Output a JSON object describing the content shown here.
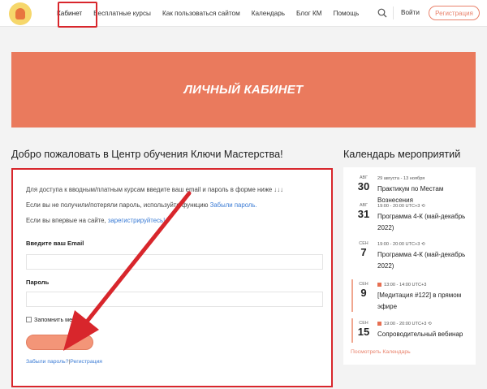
{
  "header": {
    "nav": [
      {
        "label": "Кабинет",
        "active": true
      },
      {
        "label": "Бесплатные курсы"
      },
      {
        "label": "Как пользоваться сайтом"
      },
      {
        "label": "Календарь"
      },
      {
        "label": "Блог КМ"
      },
      {
        "label": "Помощь"
      }
    ],
    "login_label": "Войти",
    "register_label": "Регистрация"
  },
  "banner": {
    "title": "ЛИЧНЫЙ КАБИНЕТ"
  },
  "main": {
    "welcome": "Добро пожаловать в Центр обучения Ключи Мастерства!",
    "intro": "Для доступа к вводным/платным курсам введите ваш email и пароль в форме ниже ↓↓↓",
    "lost_prefix": "Если вы не получили/потеряли пароль, используйте функцию ",
    "lost_link": "Забыли пароль.",
    "first_prefix": "Если вы впервые на сайте, ",
    "first_link": "зарегистрируйтесь!",
    "email_label": "Введите ваш Email",
    "password_label": "Пароль",
    "remember_label": "Запомнить меня",
    "forgot_link": "Забыли пароль?",
    "sep": "|",
    "register_link": "Регистрация"
  },
  "calendar": {
    "title": "Календарь мероприятий",
    "events": [
      {
        "month": "АВГ",
        "day": "30",
        "time": "29 августа - 13 ноября",
        "title": "Практикум по Местам Вознесения"
      },
      {
        "month": "АВГ",
        "day": "31",
        "time": "19:00 - 20:00 UTC+3",
        "title": "Программа 4-К (май-декабрь 2022)"
      },
      {
        "month": "СЕН",
        "day": "7",
        "time": "19:00 - 20:00 UTC+3",
        "title": "Программа 4-К (май-декабрь 2022)"
      },
      {
        "month": "СЕН",
        "day": "9",
        "time": "13:00 - 14:00 UTC+3",
        "title": "[Медитация #122] в прямом эфире"
      },
      {
        "month": "СЕН",
        "day": "15",
        "time": "19:00 - 20:00 UTC+3",
        "title": "Сопроводительный вебинар"
      }
    ],
    "view_link": "Посмотреть Календарь"
  },
  "colors": {
    "accent": "#ea7a5d",
    "highlight": "#d8262c",
    "link": "#3a7bd5"
  }
}
